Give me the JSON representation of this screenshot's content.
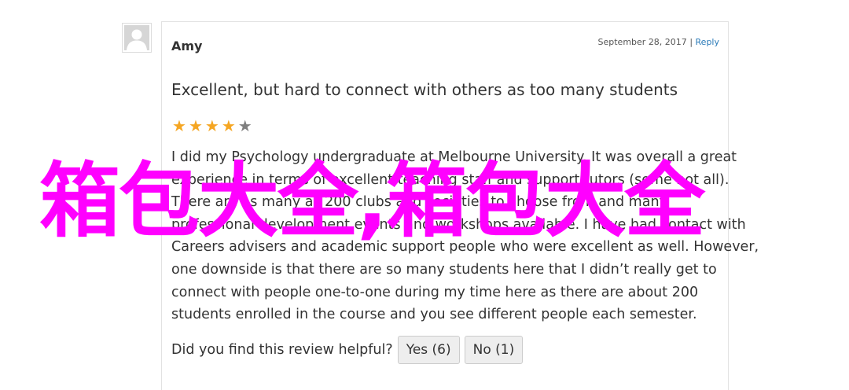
{
  "reviewer": {
    "name": "Amy",
    "date": "September 28, 2017",
    "separator": "|",
    "reply_label": "Reply"
  },
  "review": {
    "title": "Excellent, but hard to connect with others as too many students",
    "rating": 4,
    "max_rating": 5,
    "body_lines": [
      "I did my Psychology undergraduate at Melbourne University. It was overall a great",
      "experience in terms of excellent teaching staff and support tutors (some not all).",
      "There are as many as 200 clubs and societies to choose from and many",
      "professional development events and workshops available. I have had contact with",
      "Careers advisers and academic support people who were excellent as well. However,",
      "one downside is that there are so many students here that I didn’t really get to",
      "connect with people one-to-one during my time here as there are about 200",
      "students enrolled in the course and you see different people each semester."
    ]
  },
  "helpful": {
    "question": "Did you find this review helpful?",
    "yes_label": "Yes (6)",
    "no_label": "No (1)"
  },
  "watermark": {
    "text": "箱包大全,箱包大全"
  },
  "colors": {
    "star_filled": "#f5a623",
    "star_empty": "#7f7f7f",
    "link": "#2a7ab8",
    "watermark": "#ff00ff"
  },
  "icons": {
    "avatar": "default-user-silhouette-icon",
    "star": "star-icon"
  }
}
